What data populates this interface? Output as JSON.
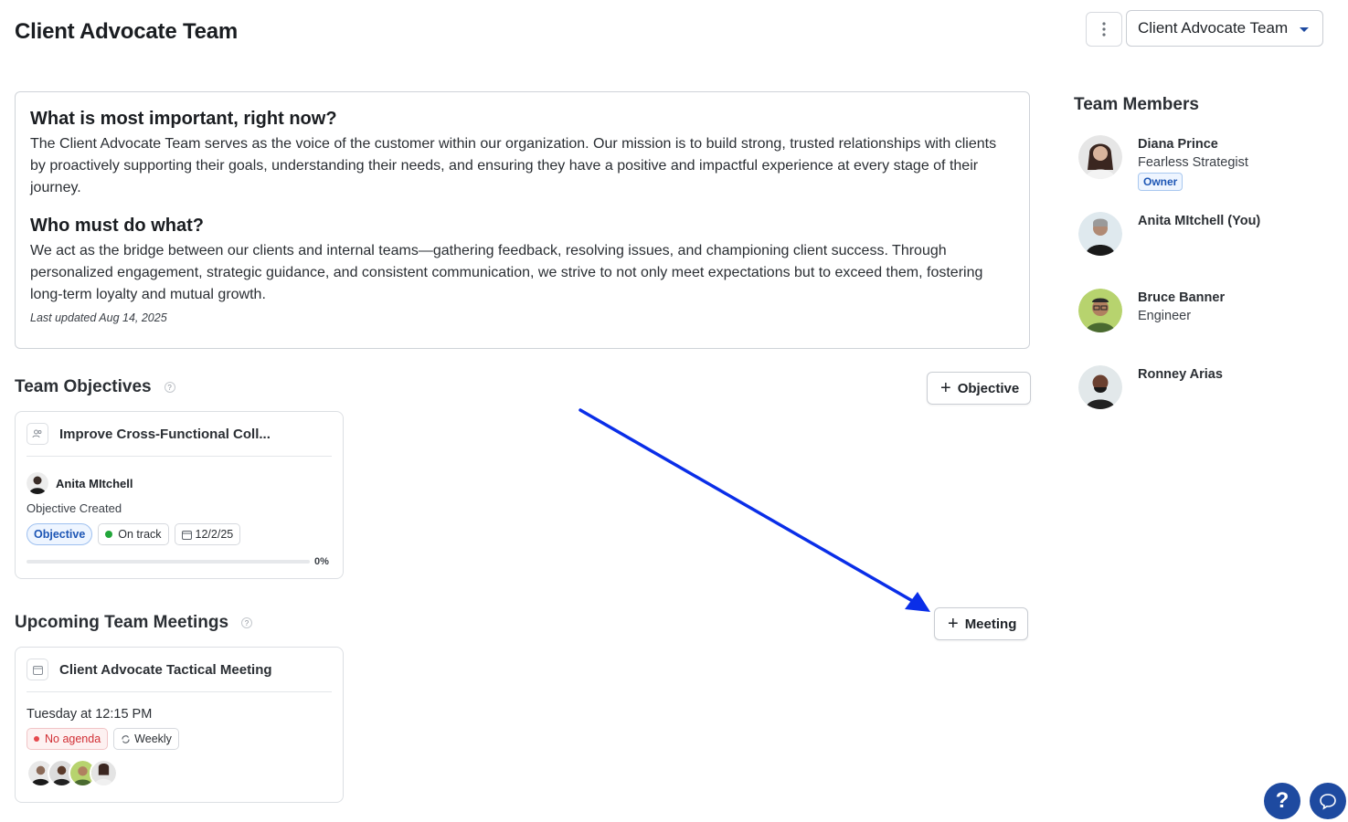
{
  "header": {
    "title": "Client Advocate Team",
    "team_selector_value": "Client Advocate Team"
  },
  "mission": {
    "heading1": "What is most important, right now?",
    "text1": "The Client Advocate Team serves as the voice of the customer within our organization. Our mission is to build strong, trusted relationships with clients by proactively supporting their goals, understanding their needs, and ensuring they have a positive and impactful experience at every stage of their journey.",
    "heading2": "Who must do what?",
    "text2": "We act as the bridge between our clients and internal teams—gathering feedback, resolving issues, and championing client success. Through personalized engagement, strategic guidance, and consistent communication, we strive to not only meet expectations but to exceed them, fostering long-term loyalty and mutual growth.",
    "updated": "Last updated Aug 14, 2025"
  },
  "objectives": {
    "title": "Team Objectives",
    "help": "?",
    "add_label": "Objective",
    "card": {
      "title": "Improve Cross-Functional Coll...",
      "owner": "Anita MItchell",
      "status": "Objective Created",
      "type_chip": "Objective",
      "track_chip": "On track",
      "date_chip": "12/2/25",
      "progress": 0,
      "progress_label": "0%"
    }
  },
  "meetings": {
    "title": "Upcoming Team Meetings",
    "help": "?",
    "add_label": "Meeting",
    "card": {
      "title": "Client Advocate Tactical Meeting",
      "time": "Tuesday at 12:15 PM",
      "agenda_chip": "No agenda",
      "recurrence_chip": "Weekly"
    }
  },
  "members": {
    "title": "Team Members",
    "list": [
      {
        "name": "Diana Prince",
        "role": "Fearless Strategist",
        "badge": "Owner"
      },
      {
        "name": "Anita MItchell (You)",
        "role": "",
        "badge": ""
      },
      {
        "name": "Bruce Banner",
        "role": "Engineer",
        "badge": ""
      },
      {
        "name": "Ronney Arias",
        "role": "",
        "badge": ""
      }
    ]
  },
  "floating": {
    "help": "?"
  },
  "colors": {
    "accent": "#1d56b5",
    "annotation_arrow": "#0a2ee8",
    "on_track": "#22a63a",
    "no_agenda": "#d12f35"
  }
}
